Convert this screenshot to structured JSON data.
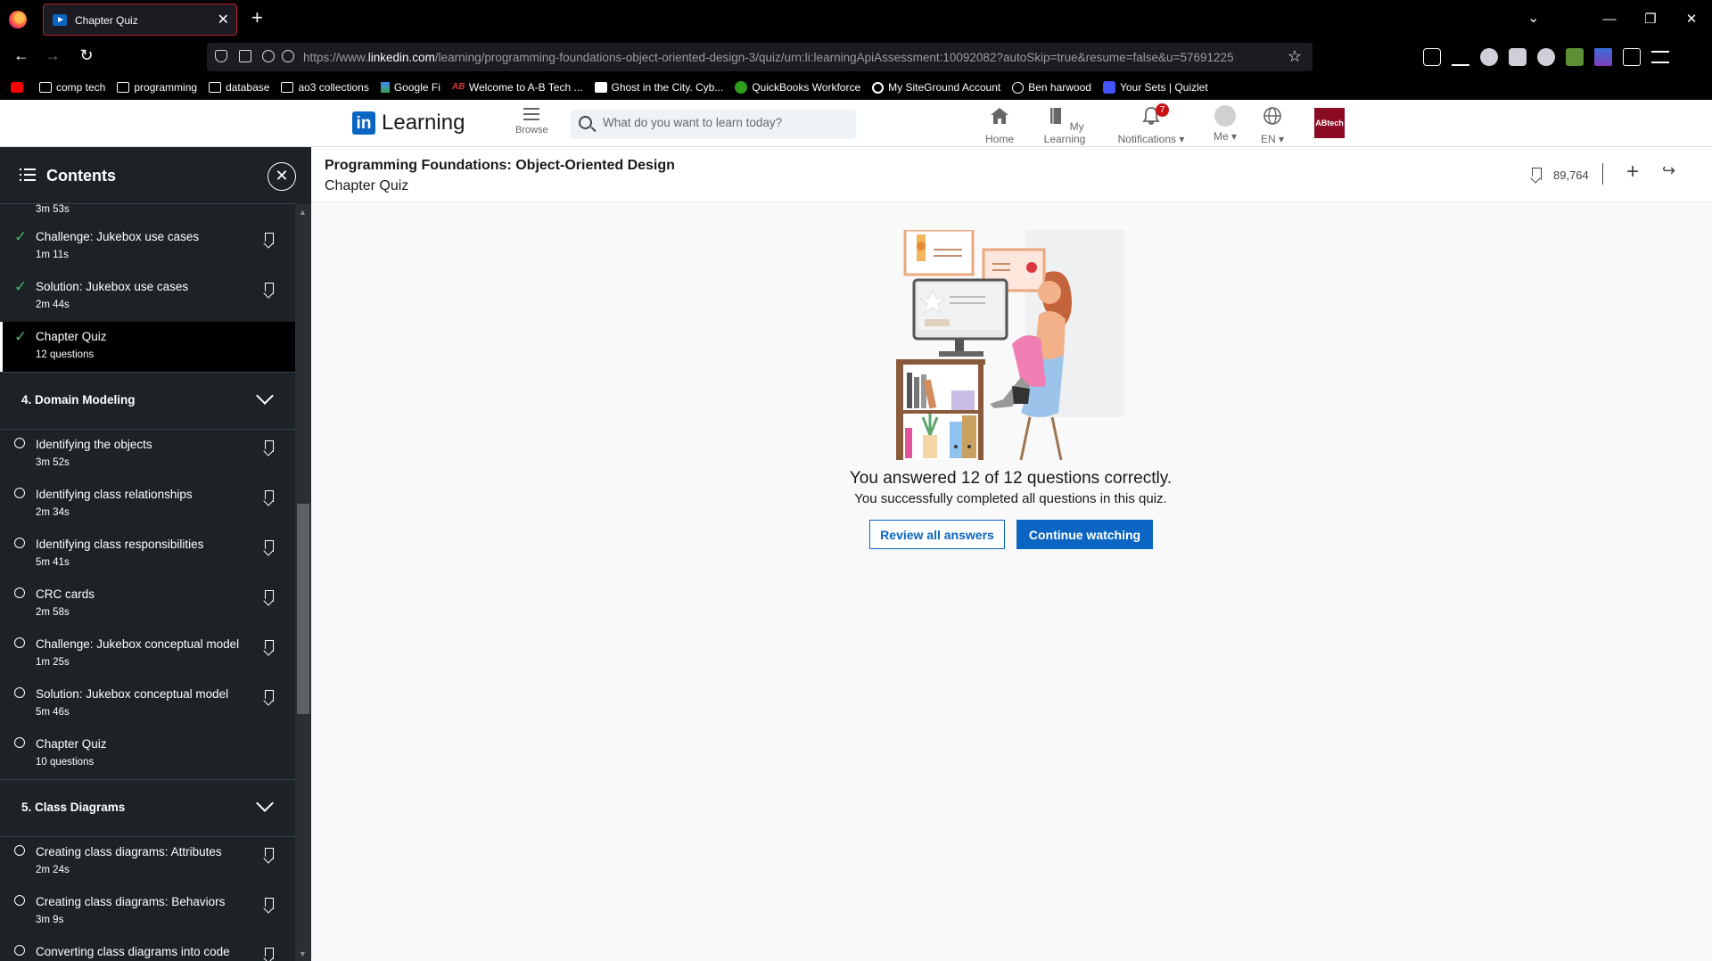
{
  "browser": {
    "tab_title": "Chapter Quiz",
    "url_prefix": "https://www.",
    "url_domain": "linkedin.com",
    "url_path": "/learning/programming-foundations-object-oriented-design-3/quiz/urn:li:learningApiAssessment:10092082?autoSkip=true&resume=false&u=57691225",
    "bookmarks": [
      {
        "label": "comp tech",
        "icon": "folder-icon"
      },
      {
        "label": "programming",
        "icon": "folder-icon"
      },
      {
        "label": "database",
        "icon": "folder-icon"
      },
      {
        "label": "ao3 collections",
        "icon": "folder-icon"
      },
      {
        "label": "Google Fi",
        "icon": "google-fi-icon"
      },
      {
        "label": "Welcome to A-B Tech ...",
        "icon": "ab-tech-icon"
      },
      {
        "label": "Ghost in the City. Cyb...",
        "icon": "sb-icon"
      },
      {
        "label": "QuickBooks Workforce",
        "icon": "quickbooks-icon"
      },
      {
        "label": "My SiteGround Account",
        "icon": "siteground-icon"
      },
      {
        "label": "Ben harwood",
        "icon": "globe-icon"
      },
      {
        "label": "Your Sets | Quizlet",
        "icon": "quizlet-icon"
      }
    ]
  },
  "header": {
    "logo_text": "Learning",
    "browse_label": "Browse",
    "search_placeholder": "What do you want to learn today?",
    "nav": {
      "home": "Home",
      "my_learning": "My Learning",
      "notifications": "Notifications",
      "notifications_count": "7",
      "me": "Me",
      "language": "EN"
    },
    "org_logo_text": "ABtech"
  },
  "sidebar": {
    "title": "Contents",
    "top_partial_duration": "3m 53s",
    "items_before": [
      {
        "title": "Challenge: Jukebox use cases",
        "detail": "1m 11s",
        "done": true
      },
      {
        "title": "Solution: Jukebox use cases",
        "detail": "2m 44s",
        "done": true
      },
      {
        "title": "Chapter Quiz",
        "detail": "12 questions",
        "done": true,
        "active": true
      }
    ],
    "section4": "4. Domain Modeling",
    "section4_items": [
      {
        "title": "Identifying the objects",
        "detail": "3m 52s"
      },
      {
        "title": "Identifying class relationships",
        "detail": "2m 34s"
      },
      {
        "title": "Identifying class responsibilities",
        "detail": "5m 41s"
      },
      {
        "title": "CRC cards",
        "detail": "2m 58s"
      },
      {
        "title": "Challenge: Jukebox conceptual model",
        "detail": "1m 25s"
      },
      {
        "title": "Solution: Jukebox conceptual model",
        "detail": "5m 46s"
      },
      {
        "title": "Chapter Quiz",
        "detail": "10 questions"
      }
    ],
    "section5": "5. Class Diagrams",
    "section5_items": [
      {
        "title": "Creating class diagrams: Attributes",
        "detail": "2m 24s"
      },
      {
        "title": "Creating class diagrams: Behaviors",
        "detail": "3m 9s"
      },
      {
        "title": "Converting class diagrams into code",
        "detail": ""
      }
    ]
  },
  "main": {
    "course_title": "Programming Foundations: Object-Oriented Design",
    "course_subtitle": "Chapter Quiz",
    "save_count": "89,764",
    "result_title": "You answered 12 of 12 questions correctly.",
    "result_subtitle": "You successfully completed all questions in this quiz.",
    "review_button": "Review all answers",
    "continue_button": "Continue watching"
  }
}
